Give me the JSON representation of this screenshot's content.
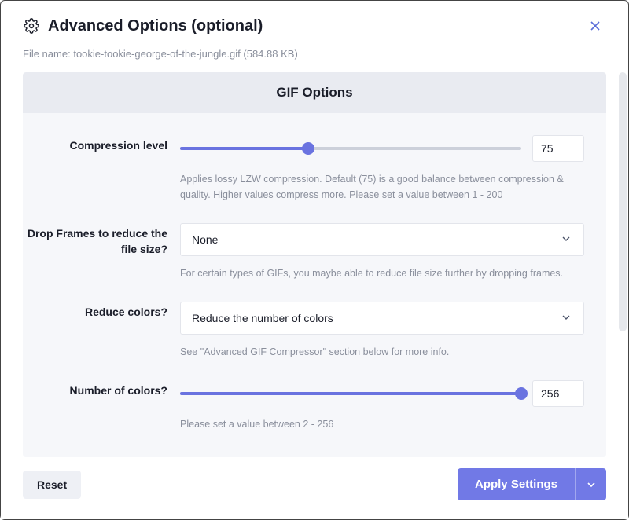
{
  "title": "Advanced Options (optional)",
  "file_name_label": "File name:",
  "file_name_value": "tookie-tookie-george-of-the-jungle.gif (584.88 KB)",
  "panel_title": "GIF Options",
  "compression": {
    "label": "Compression level",
    "value": "75",
    "percent": 37.5,
    "hint": "Applies lossy LZW compression. Default (75) is a good balance between compression & quality. Higher values compress more. Please set a value between 1 - 200"
  },
  "drop_frames": {
    "label": "Drop Frames to reduce the file size?",
    "value": "None",
    "hint": "For certain types of GIFs, you maybe able to reduce file size further by dropping frames."
  },
  "reduce_colors": {
    "label": "Reduce colors?",
    "value": "Reduce the number of colors",
    "hint": "See \"Advanced GIF Compressor\" section below for more info."
  },
  "num_colors": {
    "label": "Number of colors?",
    "value": "256",
    "percent": 100,
    "hint": "Please set a value between 2 - 256"
  },
  "footer": {
    "reset": "Reset",
    "apply": "Apply Settings"
  }
}
